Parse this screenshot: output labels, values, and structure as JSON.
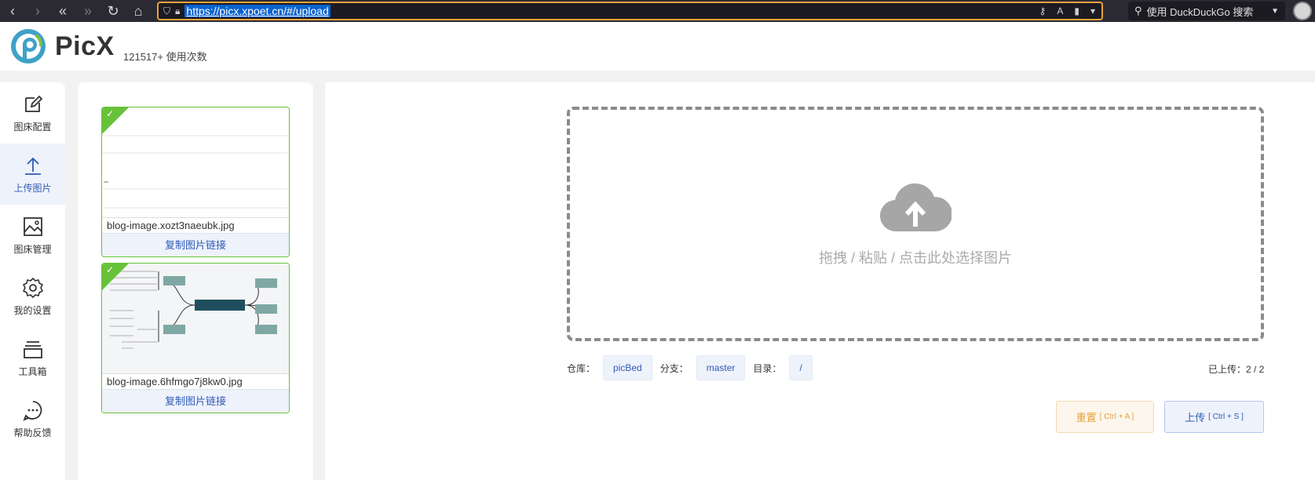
{
  "browser": {
    "url": "https://picx.xpoet.cn/#/upload",
    "search_placeholder": "使用 DuckDuckGo 搜索"
  },
  "header": {
    "brand": "PicX",
    "usage": "121517+ 使用次数"
  },
  "sidebar": {
    "items": [
      {
        "label": "图床配置",
        "icon": "edit-icon"
      },
      {
        "label": "上传图片",
        "icon": "upload-icon"
      },
      {
        "label": "图床管理",
        "icon": "image-icon"
      },
      {
        "label": "我的设置",
        "icon": "gear-icon"
      },
      {
        "label": "工具箱",
        "icon": "toolbox-icon"
      },
      {
        "label": "帮助反馈",
        "icon": "chat-icon"
      }
    ],
    "active_index": 1
  },
  "uploads": {
    "items": [
      {
        "filename": "blog-image.xozt3naeubk.jpg",
        "copy_label": "复制图片链接"
      },
      {
        "filename": "blog-image.6hfmgo7j8kw0.jpg",
        "copy_label": "复制图片链接"
      }
    ]
  },
  "upload_area": {
    "drop_text": "拖拽 / 粘贴 / 点击此处选择图片"
  },
  "repo_info": {
    "repo_label": "仓库：",
    "repo_value": "picBed",
    "branch_label": "分支：",
    "branch_value": "master",
    "dir_label": "目录：",
    "dir_value": "/",
    "uploaded": "已上传：2 / 2"
  },
  "actions": {
    "reset_label": "重置",
    "reset_shortcut": "[ Ctrl + A ]",
    "upload_label": "上传",
    "upload_shortcut": "[ Ctrl + S ]"
  },
  "colors": {
    "accent": "#2f5bb7",
    "success": "#67c23a",
    "warning": "#e6a23c"
  }
}
